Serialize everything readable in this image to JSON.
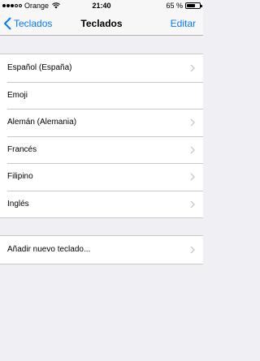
{
  "status_bar": {
    "carrier": "Orange",
    "time": "21:40",
    "battery_percent": "65 %",
    "battery_level": 0.65,
    "signal_bars_filled": 3,
    "signal_bars_total": 5
  },
  "nav": {
    "back_label": "Teclados",
    "title": "Teclados",
    "edit_label": "Editar"
  },
  "keyboards": [
    {
      "label": "Español (España)",
      "chevron": true
    },
    {
      "label": "Emoji",
      "chevron": false
    },
    {
      "label": "Alemán (Alemania)",
      "chevron": true
    },
    {
      "label": "Francés",
      "chevron": true
    },
    {
      "label": "Filipino",
      "chevron": true
    },
    {
      "label": "Inglés",
      "chevron": true
    }
  ],
  "add_keyboard": {
    "label": "Añadir nuevo teclado...",
    "chevron": true
  },
  "colors": {
    "accent": "#007aff",
    "background": "#efeff4",
    "separator": "#c8c7cc",
    "chevron": "#c7c7cc"
  },
  "icons": {
    "back": "chevron-left-icon",
    "disclosure": "chevron-right-icon",
    "wifi": "wifi-icon",
    "battery": "battery-icon"
  }
}
